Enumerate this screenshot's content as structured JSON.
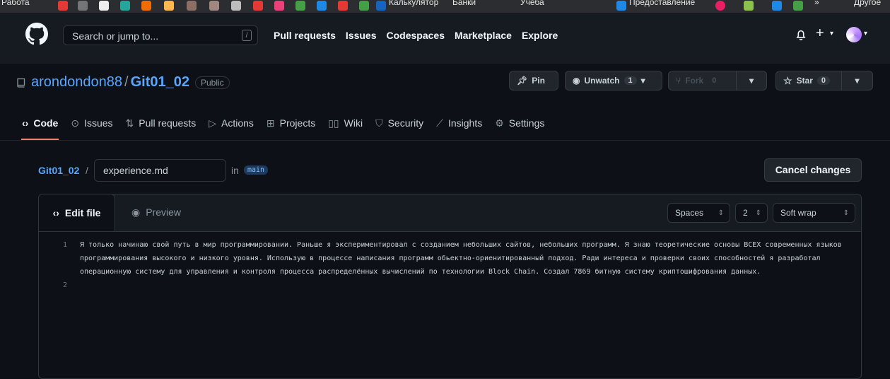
{
  "bookmarks": {
    "items": [
      "Работа",
      "Калькулятор",
      "Банки",
      "Учеба",
      "Предоставление",
      "Другое"
    ],
    "overflow": "»"
  },
  "header": {
    "search_placeholder": "Search or jump to...",
    "search_shortcut": "/",
    "nav": [
      "Pull requests",
      "Issues",
      "Codespaces",
      "Marketplace",
      "Explore"
    ]
  },
  "repo": {
    "owner": "arondondon88",
    "name": "Git01_02",
    "visibility": "Public",
    "pin_label": "Pin",
    "unwatch_label": "Unwatch",
    "unwatch_count": "1",
    "fork_label": "Fork",
    "fork_count": "0",
    "star_label": "Star",
    "star_count": "0",
    "tabs": [
      "Code",
      "Issues",
      "Pull requests",
      "Actions",
      "Projects",
      "Wiki",
      "Security",
      "Insights",
      "Settings"
    ]
  },
  "edit": {
    "crumb": "Git01_02",
    "filename": "experience.md",
    "in_text": "in",
    "branch": "main",
    "cancel_label": "Cancel changes",
    "tab_edit": "Edit file",
    "tab_preview": "Preview",
    "indent_mode": "Spaces",
    "indent_size": "2",
    "wrap_mode": "Soft wrap",
    "lines": [
      {
        "num": "1",
        "text": "Я только начинаю свой путь в мир программировании. Раньше я экспериментировал с созданием небольших сайтов, небольших программ. Я знаю теоретические основы ВСЕХ современных языков программирования высокого и низкого уровня. Использую в процессе написания программ обьектно-ориенитированный подход. Ради интереса и проверки своих способностей я разработал операционную систему для управления и контроля процесса распределённых вычислений по технологии Block Chain. Создал 7869 битную систему криптошифрования данных."
      },
      {
        "num": "2",
        "text": ""
      }
    ]
  },
  "colors": {
    "accent_link": "#58a6ff",
    "tab_underline": "#f78166",
    "background": "#0d1117",
    "header_bg": "#161b22"
  }
}
